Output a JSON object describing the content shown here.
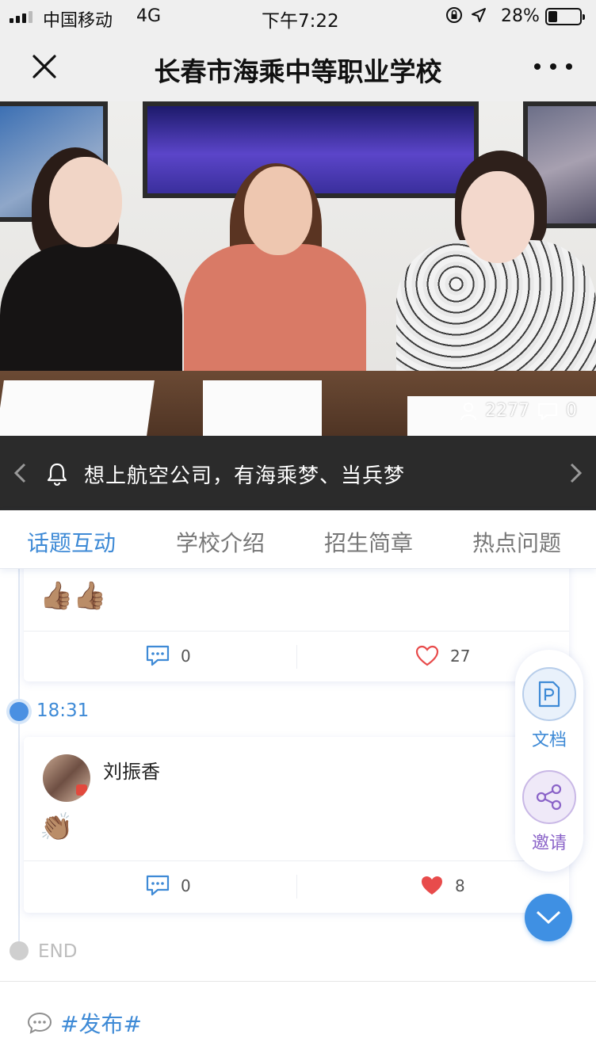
{
  "status_bar": {
    "carrier": "中国移动",
    "network": "4G",
    "time": "下午7:22",
    "battery_percent": "28%",
    "battery_level": 0.28
  },
  "nav": {
    "title": "长春市海乘中等职业学校"
  },
  "video": {
    "viewers": "2277",
    "comments": "0"
  },
  "notice": {
    "text": "想上航空公司，有海乘梦、当兵梦"
  },
  "tabs": [
    {
      "label": "话题互动",
      "active": true
    },
    {
      "label": "学校介绍",
      "active": false
    },
    {
      "label": "招生简章",
      "active": false
    },
    {
      "label": "热点问题",
      "active": false
    }
  ],
  "feed": {
    "posts": [
      {
        "emoji": "👍🏽👍🏽",
        "comment_count": "0",
        "like_count": "27",
        "liked": false
      },
      {
        "time": "18:31",
        "author": "刘振香",
        "emoji": "👏🏽",
        "comment_count": "0",
        "like_count": "8",
        "liked": true
      }
    ],
    "end_label": "END"
  },
  "side_panel": {
    "doc_label": "文档",
    "invite_label": "邀请"
  },
  "bottom": {
    "publish_label": "#发布#"
  },
  "colors": {
    "accent": "#3e8ad6",
    "invite": "#8a63c8",
    "like_active": "#e84b4b",
    "notice_bg": "#2b2b2b"
  }
}
